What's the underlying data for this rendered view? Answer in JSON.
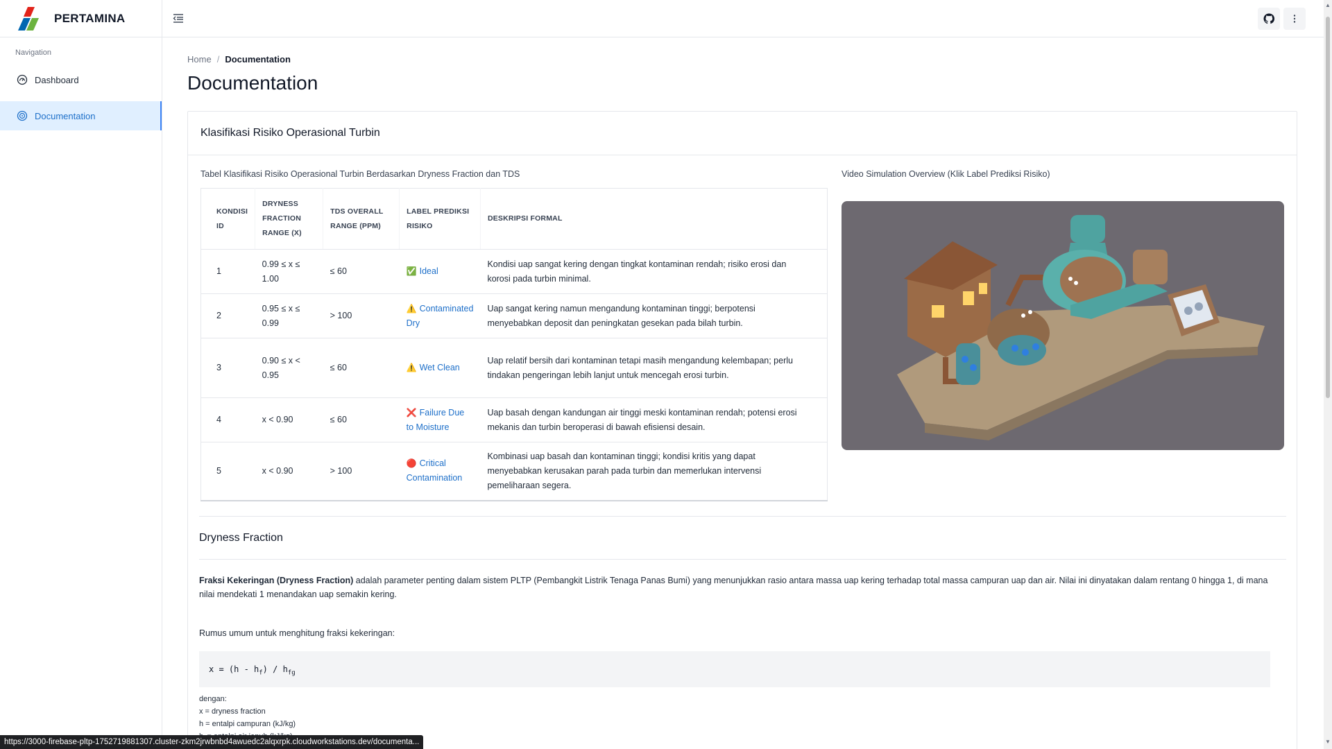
{
  "brand": {
    "name": "PERTAMINA"
  },
  "sidebar": {
    "heading": "Navigation",
    "items": [
      {
        "label": "Dashboard",
        "icon": "dashboard-gauge-icon"
      },
      {
        "label": "Documentation",
        "icon": "documentation-target-icon",
        "active": true
      }
    ]
  },
  "topbar": {
    "icons": [
      "menu-collapse-icon",
      "github-icon",
      "more-vertical-icon"
    ]
  },
  "breadcrumb": {
    "home": "Home",
    "separator": "/",
    "current": "Documentation"
  },
  "page": {
    "title": "Documentation"
  },
  "card": {
    "title": "Klasifikasi Risiko Operasional Turbin",
    "table_caption": "Tabel Klasifikasi Risiko Operasional Turbin Berdasarkan Dryness Fraction dan TDS",
    "video_caption": "Video Simulation Overview (Klik Label Prediksi Risiko)",
    "table": {
      "headers": {
        "h1": "KONDISI ID",
        "h2": "DRYNESS FRACTION RANGE (X)",
        "h3": "TDS OVERALL RANGE (PPM)",
        "h4": "LABEL PREDIKSI RISIKO",
        "h5": "DESKRIPSI FORMAL"
      },
      "rows": [
        {
          "id": "1",
          "dryness": "0.99 ≤ x ≤ 1.00",
          "tds": "≤ 60",
          "emoji": "✅",
          "label": "Ideal",
          "desc": "Kondisi uap sangat kering dengan tingkat kontaminan rendah; risiko erosi dan korosi pada turbin minimal."
        },
        {
          "id": "2",
          "dryness": "0.95 ≤ x ≤ 0.99",
          "tds": "> 100",
          "emoji": "⚠️",
          "label": "Contaminated Dry",
          "desc": "Uap sangat kering namun mengandung kontaminan tinggi; berpotensi menyebabkan deposit dan peningkatan gesekan pada bilah turbin."
        },
        {
          "id": "3",
          "dryness": "0.90 ≤ x < 0.95",
          "tds": "≤ 60",
          "emoji": "⚠️",
          "label": "Wet Clean",
          "desc": "Uap relatif bersih dari kontaminan tetapi masih mengandung kelembapan; perlu tindakan pengeringan lebih lanjut untuk mencegah erosi turbin."
        },
        {
          "id": "4",
          "dryness": "x < 0.90",
          "tds": "≤ 60",
          "emoji": "❌",
          "label": "Failure Due to Moisture",
          "desc": "Uap basah dengan kandungan air tinggi meski kontaminan rendah; potensi erosi mekanis dan turbin beroperasi di bawah efisiensi desain."
        },
        {
          "id": "5",
          "dryness": "x < 0.90",
          "tds": "> 100",
          "emoji": "🔴",
          "label": "Critical Contamination",
          "desc": "Kombinasi uap basah dan kontaminan tinggi; kondisi kritis yang dapat menyebabkan kerusakan parah pada turbin dan memerlukan intervensi pemeliharaan segera."
        }
      ]
    }
  },
  "dryness": {
    "title": "Dryness Fraction",
    "intro_bold": "Fraksi Kekeringan (Dryness Fraction)",
    "intro_rest": " adalah parameter penting dalam sistem PLTP (Pembangkit Listrik Tenaga Panas Bumi) yang menunjukkan rasio antara massa uap kering terhadap total massa campuran uap dan air. Nilai ini dinyatakan dalam rentang 0 hingga 1, di mana nilai mendekati 1 menandakan uap semakin kering.",
    "formula_intro": "Rumus umum untuk menghitung fraksi kekeringan:",
    "formula": {
      "lhs": "x = (h - h",
      "sub1": "f",
      "mid": ") / h",
      "sub2": "fg"
    },
    "defs": {
      "intro": "dengan:",
      "d1": "x = dryness fraction",
      "d2": "h = entalpi campuran (kJ/kg)",
      "d3_pre": "h",
      "d3_sub": "f",
      "d3_post": " = entalpi air jenuh (kJ/kg)"
    }
  },
  "status_url": "https://3000-firebase-pltp-1752719881307.cluster-zkm2jrwbnbd4awuedc2alqxrpk.cloudworkstations.dev/documenta..."
}
